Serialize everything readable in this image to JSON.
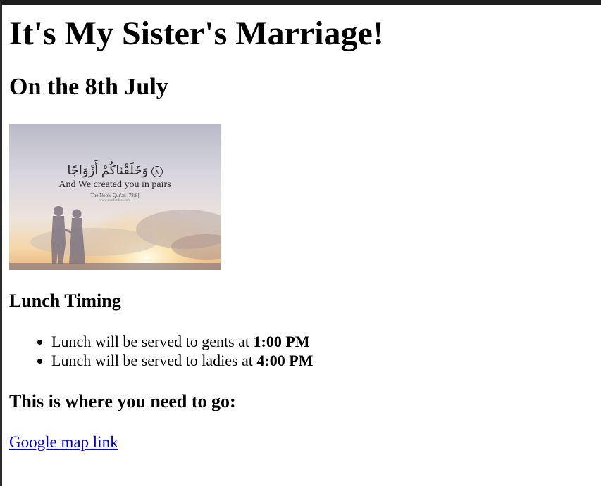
{
  "page": {
    "title": "It's My Sister's Marriage!",
    "subtitle": "On the 8th July"
  },
  "image": {
    "arabic_text": "وَخَلَقْنَاكُمْ أَزْوَاجًا",
    "verse_number": "٨",
    "english_text": "And We created you in pairs",
    "source": "The Noble Qur'an [78:8]",
    "site": "www.muslimfeel.com"
  },
  "lunch": {
    "heading": "Lunch Timing",
    "items": [
      {
        "text": "Lunch will be served to gents at ",
        "time": "1:00 PM"
      },
      {
        "text": "Lunch will be served to ladies at ",
        "time": "4:00 PM"
      }
    ]
  },
  "location": {
    "heading": "This is where you need to go:",
    "link_label": "Google map link"
  },
  "colors": {
    "link": "#0000ee",
    "window_frame": "#1f1f1f"
  }
}
